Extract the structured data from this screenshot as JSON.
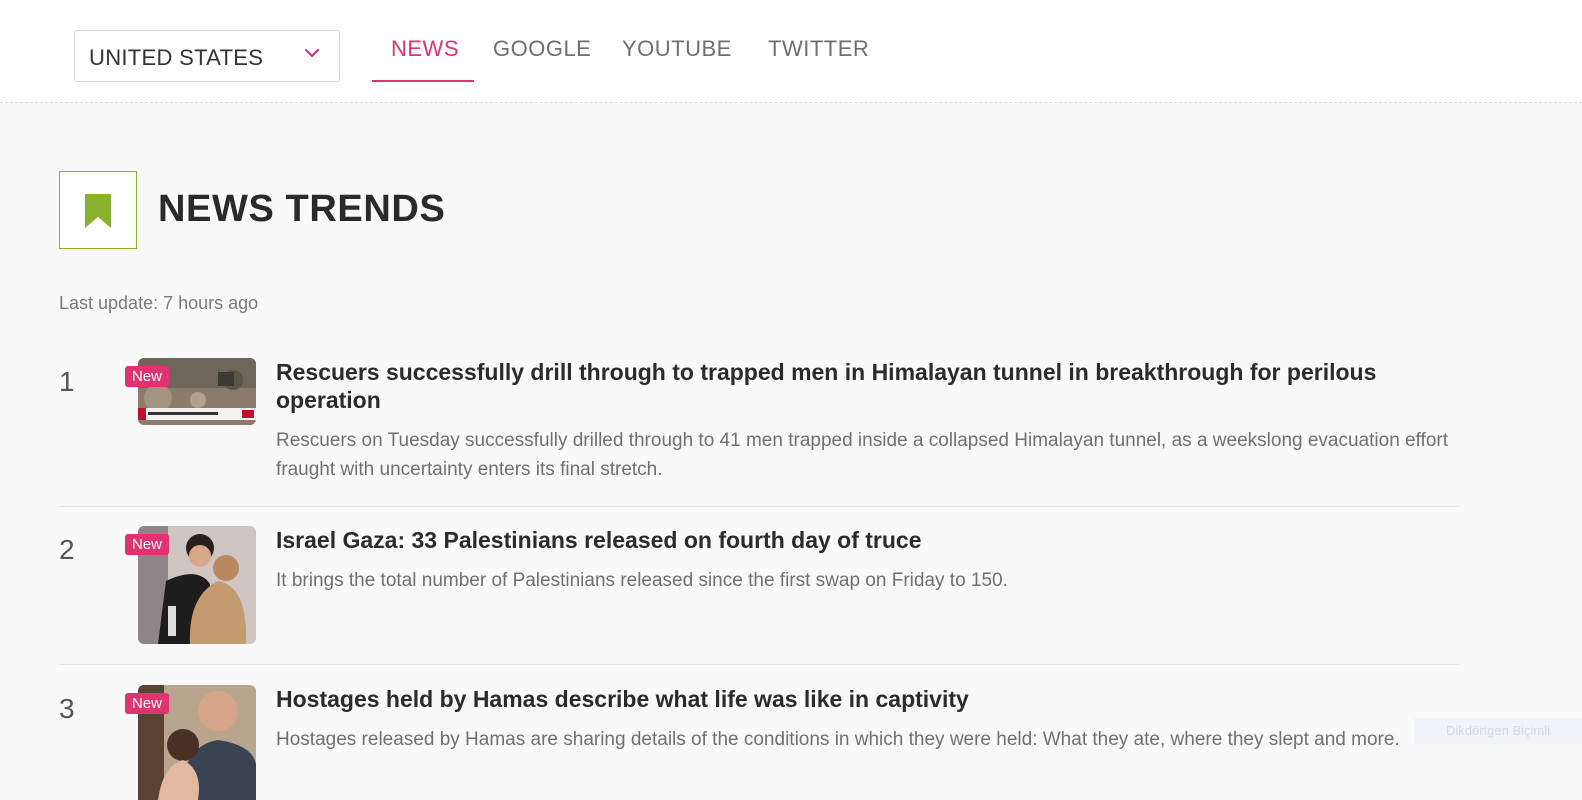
{
  "country_select": {
    "value": "UNITED STATES"
  },
  "tabs": [
    {
      "label": "NEWS",
      "active": true
    },
    {
      "label": "GOOGLE",
      "active": false
    },
    {
      "label": "YOUTUBE",
      "active": false
    },
    {
      "label": "TWITTER",
      "active": false
    }
  ],
  "header": {
    "title": "NEWS TRENDS",
    "icon": "bookmark-icon"
  },
  "last_update": "Last update: 7 hours ago",
  "news": [
    {
      "rank": "1",
      "badge": "New",
      "headline": "Rescuers successfully drill through to trapped men in Himalayan tunnel in breakthrough for perilous operation",
      "summary": "Rescuers on Tuesday successfully drilled through to 41 men trapped inside a collapsed Himalayan tunnel, as a weekslong evacuation effort fraught with uncertainty enters its final stretch."
    },
    {
      "rank": "2",
      "badge": "New",
      "headline": "Israel Gaza: 33 Palestinians released on fourth day of truce",
      "summary": "It brings the total number of Palestinians released since the first swap on Friday to 150."
    },
    {
      "rank": "3",
      "badge": "New",
      "headline": "Hostages held by Hamas describe what life was like in captivity",
      "summary": "Hostages released by Hamas are sharing details of the conditions in which they were held: What they ate, where they slept and more."
    }
  ],
  "overlay_label": "Dikdörtgen Biçimli",
  "colors": {
    "accent": "#e0336f",
    "icon_green": "#8ab12d"
  }
}
